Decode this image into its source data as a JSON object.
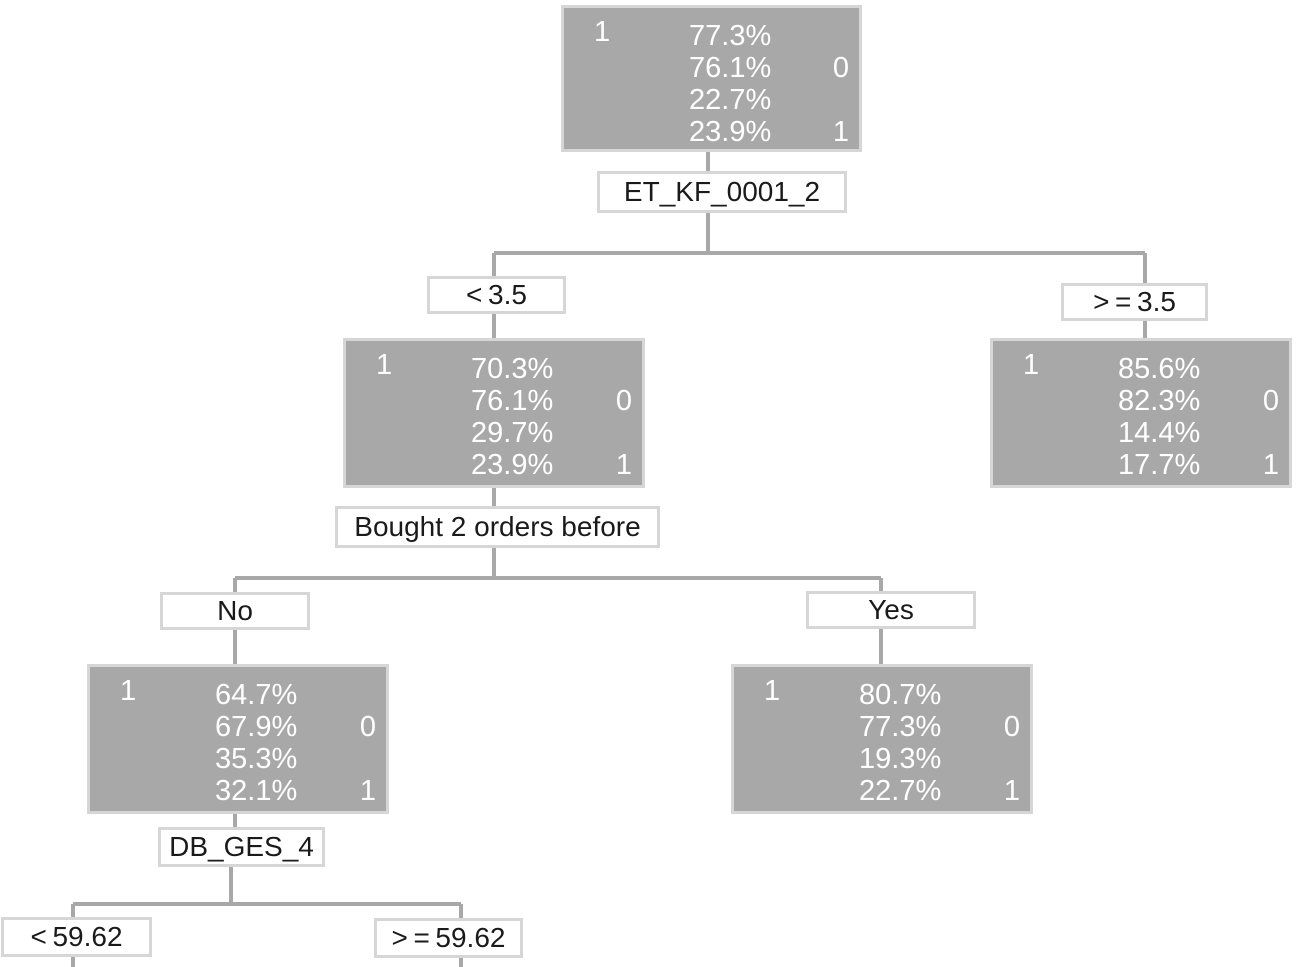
{
  "tree": {
    "root": {
      "class": "1",
      "percentages": [
        "77.3%",
        "76.1%",
        "22.7%",
        "23.9%"
      ],
      "label_0": "0",
      "label_1": "1",
      "split_variable": "ET_KF_0001_2"
    },
    "left": {
      "condition": "< 3.5",
      "class": "1",
      "percentages": [
        "70.3%",
        "76.1%",
        "29.7%",
        "23.9%"
      ],
      "label_0": "0",
      "label_1": "1",
      "split_variable": "Bought 2 orders before"
    },
    "right": {
      "condition": "> = 3.5",
      "class": "1",
      "percentages": [
        "85.6%",
        "82.3%",
        "14.4%",
        "17.7%"
      ],
      "label_0": "0",
      "label_1": "1"
    },
    "left_no": {
      "condition": "No",
      "class": "1",
      "percentages": [
        "64.7%",
        "67.9%",
        "35.3%",
        "32.1%"
      ],
      "label_0": "0",
      "label_1": "1",
      "split_variable": "DB_GES_4"
    },
    "left_yes": {
      "condition": "Yes",
      "class": "1",
      "percentages": [
        "80.7%",
        "77.3%",
        "19.3%",
        "22.7%"
      ],
      "label_0": "0",
      "label_1": "1"
    },
    "no_lt": {
      "condition": "< 59.62"
    },
    "no_ge": {
      "condition": "> = 59.62"
    }
  },
  "colors": {
    "node_fill": "#a8a8a8",
    "node_border": "#d6d6d6",
    "connector": "#a8a8a8",
    "node_text": "#ffffff",
    "label_text": "#1a1a1a"
  }
}
